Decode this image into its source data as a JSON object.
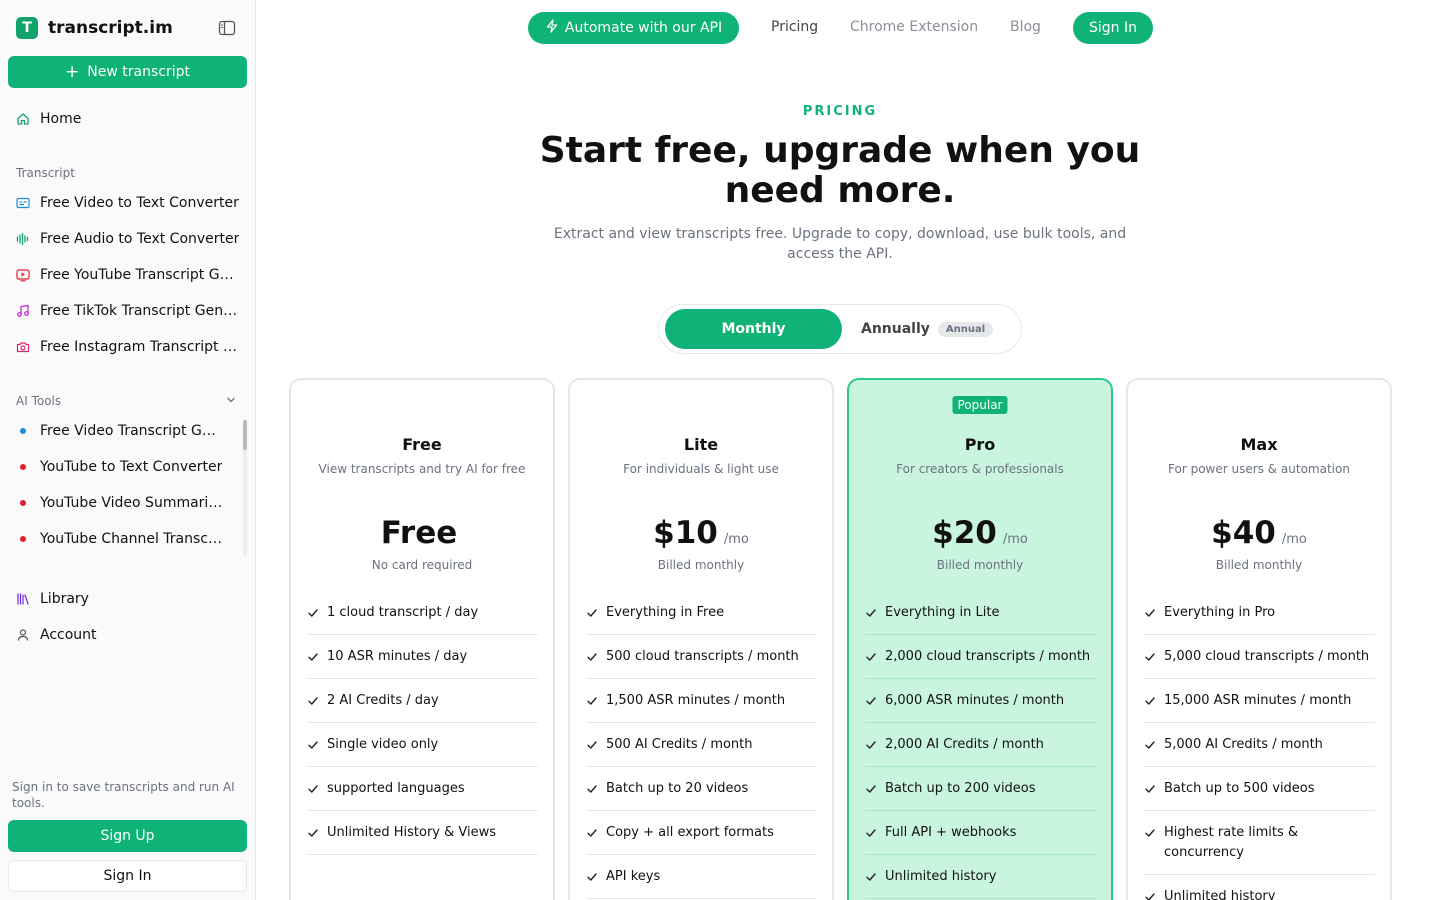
{
  "brand": {
    "logo_letter": "T",
    "name": "transcript.im"
  },
  "sidebar": {
    "new_button": "New transcript",
    "home": "Home",
    "transcript_section": "Transcript",
    "transcript_items": [
      {
        "label": "Free Video to Text Converter",
        "icon": "video-caption-icon"
      },
      {
        "label": "Free Audio to Text Converter",
        "icon": "audio-wave-icon"
      },
      {
        "label": "Free YouTube Transcript Generator",
        "icon": "youtube-icon"
      },
      {
        "label": "Free TikTok Transcript Generator",
        "icon": "music-note-icon"
      },
      {
        "label": "Free Instagram Transcript Generator",
        "icon": "camera-icon"
      }
    ],
    "ai_section": "AI Tools",
    "ai_items": [
      {
        "label": "Free Video Transcript Generator",
        "dot_color": "#1d8be0"
      },
      {
        "label": "YouTube to Text Converter",
        "dot_color": "#e11d2e"
      },
      {
        "label": "YouTube Video Summarizer",
        "dot_color": "#e11d2e"
      },
      {
        "label": "YouTube Channel Transcript",
        "dot_color": "#e11d2e"
      }
    ],
    "library": "Library",
    "account": "Account",
    "signin_note": "Sign in to save transcripts and run AI tools.",
    "signup": "Sign Up",
    "signin": "Sign In"
  },
  "topnav": {
    "api": "Automate with our API",
    "pricing": "Pricing",
    "chrome": "Chrome Extension",
    "blog": "Blog",
    "signin": "Sign In"
  },
  "hero": {
    "eyebrow": "PRICING",
    "title": "Start free, upgrade when you need more.",
    "subtitle": "Extract and view transcripts free. Upgrade to copy, download, use bulk tools, and access the API."
  },
  "toggle": {
    "monthly": "Monthly",
    "annually": "Annually",
    "badge": "Annual",
    "selected": "Monthly"
  },
  "plans": [
    {
      "name": "Free",
      "desc": "View transcripts and try AI for free",
      "price": "Free",
      "per": "",
      "billing": "No card required",
      "popular": false,
      "features": [
        "1 cloud transcript / day",
        "10 ASR minutes / day",
        "2 AI Credits / day",
        "Single video only",
        "supported languages",
        "Unlimited History & Views"
      ]
    },
    {
      "name": "Lite",
      "desc": "For individuals & light use",
      "price": "$10",
      "per": "/mo",
      "billing": "Billed monthly",
      "popular": false,
      "features": [
        "Everything in Free",
        "500 cloud transcripts / month",
        "1,500 ASR minutes / month",
        "500 AI Credits / month",
        "Batch up to 20 videos",
        "Copy + all export formats",
        "API keys"
      ]
    },
    {
      "name": "Pro",
      "desc": "For creators & professionals",
      "price": "$20",
      "per": "/mo",
      "billing": "Billed monthly",
      "popular": true,
      "popular_label": "Popular",
      "features": [
        "Everything in Lite",
        "2,000 cloud transcripts / month",
        "6,000 ASR minutes / month",
        "2,000 AI Credits / month",
        "Batch up to 200 videos",
        "Full API + webhooks",
        "Unlimited history"
      ]
    },
    {
      "name": "Max",
      "desc": "For power users & automation",
      "price": "$40",
      "per": "/mo",
      "billing": "Billed monthly",
      "popular": false,
      "features": [
        "Everything in Pro",
        "5,000 cloud transcripts / month",
        "15,000 ASR minutes / month",
        "5,000 AI Credits / month",
        "Batch up to 500 videos",
        "Highest rate limits & concurrency",
        "Unlimited history"
      ]
    }
  ],
  "colors": {
    "accent": "#10b377",
    "popular_bg": "#c9f5df"
  }
}
